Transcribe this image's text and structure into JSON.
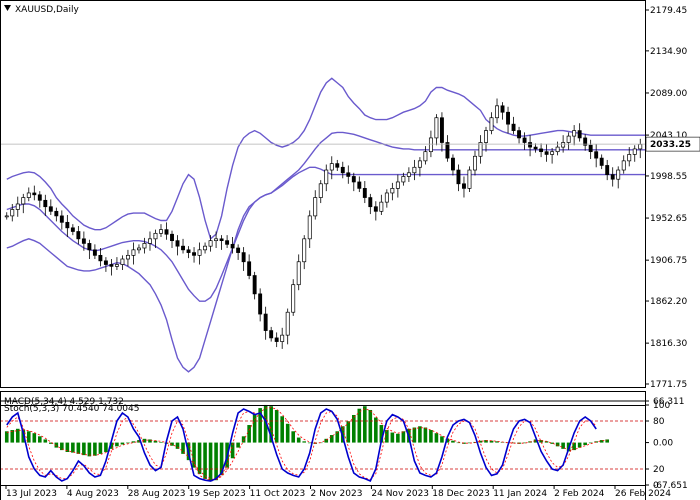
{
  "header": {
    "symbol_label": "XAUUSD,Daily",
    "symbol_icon": "triangle-down-icon"
  },
  "chart_data": [
    {
      "type": "candlestick",
      "symbol": "XAUUSD",
      "timeframe": "Daily",
      "current_price_label": "2033.25",
      "y_ticks": [
        "2179.45",
        "2134.90",
        "2089.00",
        "2043.10",
        "1998.55",
        "1952.65",
        "1906.75",
        "1862.20",
        "1816.30",
        "1771.75"
      ],
      "ylim": [
        1771.75,
        2179.45
      ],
      "x_ticks": [
        "13 Jul 2023",
        "4 Aug 2023",
        "28 Aug 2023",
        "19 Sep 2023",
        "11 Oct 2023",
        "2 Nov 2023",
        "24 Nov 2023",
        "18 Dec 2023",
        "11 Jan 2024",
        "2 Feb 2024",
        "26 Feb 2024"
      ],
      "close": [
        1955,
        1962,
        1968,
        1975,
        1980,
        1978,
        1972,
        1965,
        1960,
        1955,
        1948,
        1942,
        1938,
        1930,
        1925,
        1918,
        1912,
        1906,
        1902,
        1900,
        1902,
        1908,
        1912,
        1918,
        1920,
        1925,
        1930,
        1936,
        1940,
        1935,
        1928,
        1922,
        1918,
        1915,
        1912,
        1918,
        1922,
        1928,
        1930,
        1928,
        1924,
        1920,
        1915,
        1905,
        1890,
        1870,
        1848,
        1830,
        1822,
        1818,
        1825,
        1850,
        1880,
        1905,
        1930,
        1955,
        1975,
        1990,
        2005,
        2012,
        2008,
        2002,
        1998,
        1992,
        1985,
        1975,
        1965,
        1960,
        1970,
        1980,
        1985,
        1992,
        1998,
        2002,
        2008,
        2015,
        2025,
        2040,
        2062,
        2035,
        2018,
        2005,
        1990,
        1985,
        2005,
        2020,
        2035,
        2048,
        2062,
        2075,
        2068,
        2055,
        2048,
        2040,
        2035,
        2030,
        2028,
        2025,
        2022,
        2025,
        2030,
        2035,
        2042,
        2048,
        2040,
        2032,
        2025,
        2018,
        2010,
        2000,
        1995,
        2005,
        2015,
        2022,
        2028,
        2033
      ],
      "bollinger_upper": [
        1995,
        1998,
        2000,
        2002,
        2003,
        2002,
        1998,
        1992,
        1985,
        1975,
        1968,
        1962,
        1955,
        1950,
        1945,
        1942,
        1940,
        1940,
        1942,
        1946,
        1950,
        1954,
        1957,
        1958,
        1958,
        1958,
        1955,
        1952,
        1950,
        1950,
        1960,
        1975,
        1990,
        2000,
        1995,
        1975,
        1950,
        1930,
        1935,
        1955,
        1985,
        2010,
        2030,
        2040,
        2045,
        2048,
        2045,
        2040,
        2035,
        2032,
        2030,
        2032,
        2035,
        2040,
        2048,
        2060,
        2075,
        2090,
        2100,
        2105,
        2100,
        2095,
        2085,
        2078,
        2072,
        2065,
        2062,
        2060,
        2060,
        2060,
        2062,
        2065,
        2068,
        2070,
        2072,
        2075,
        2080,
        2090,
        2095,
        2095,
        2092,
        2090,
        2088,
        2085,
        2080,
        2075,
        2070,
        2060,
        2055,
        2050,
        2047,
        2045,
        2043,
        2042,
        2042,
        2043,
        2044,
        2045,
        2046,
        2047,
        2048,
        2048,
        2047,
        2046,
        2045,
        2044,
        2043,
        2043,
        2043,
        2043,
        2043,
        2043,
        2043,
        2043,
        2043,
        2043,
        2043
      ],
      "bollinger_middle": [
        1962,
        1964,
        1966,
        1968,
        1968,
        1966,
        1962,
        1956,
        1950,
        1944,
        1938,
        1933,
        1928,
        1924,
        1920,
        1918,
        1917,
        1918,
        1920,
        1922,
        1924,
        1926,
        1927,
        1928,
        1928,
        1927,
        1925,
        1922,
        1918,
        1912,
        1905,
        1895,
        1885,
        1875,
        1868,
        1862,
        1862,
        1866,
        1876,
        1890,
        1905,
        1920,
        1935,
        1950,
        1962,
        1970,
        1975,
        1978,
        1980,
        1985,
        1990,
        1995,
        2000,
        2005,
        2012,
        2020,
        2028,
        2035,
        2040,
        2045,
        2046,
        2046,
        2045,
        2044,
        2042,
        2040,
        2038,
        2036,
        2034,
        2032,
        2030,
        2029,
        2028,
        2028,
        2027,
        2027,
        2027,
        2027,
        2027,
        2027,
        2027,
        2027,
        2027,
        2027,
        2027,
        2027,
        2027,
        2027,
        2027,
        2027,
        2027,
        2027,
        2027,
        2027,
        2027,
        2027,
        2027,
        2027,
        2027,
        2027,
        2027,
        2027,
        2027,
        2027,
        2027,
        2027,
        2027,
        2027,
        2027,
        2027,
        2027,
        2027,
        2027,
        2027,
        2027,
        2027,
        2027
      ],
      "bollinger_lower": [
        1920,
        1922,
        1925,
        1928,
        1930,
        1928,
        1925,
        1920,
        1915,
        1910,
        1905,
        1900,
        1898,
        1896,
        1895,
        1895,
        1896,
        1898,
        1900,
        1902,
        1904,
        1903,
        1900,
        1896,
        1892,
        1886,
        1880,
        1870,
        1858,
        1842,
        1820,
        1800,
        1790,
        1785,
        1790,
        1800,
        1820,
        1840,
        1860,
        1880,
        1900,
        1920,
        1940,
        1955,
        1965,
        1970,
        1975,
        1978,
        1980,
        1984,
        1988,
        1993,
        1998,
        2002,
        2005,
        2008,
        2008,
        2006,
        2003,
        2000,
        2000,
        2000,
        2000,
        2000,
        2000,
        2000,
        2000,
        2000,
        2000,
        2000,
        2000,
        2000,
        2000,
        2000,
        2000,
        2000,
        2000,
        2000,
        2000,
        2000,
        2000,
        2000,
        2000,
        2000,
        2000,
        2000,
        2000,
        2000,
        2000,
        2000,
        2000,
        2000,
        2000,
        2000,
        2000,
        2000,
        2000,
        2000,
        2000,
        2000,
        2000,
        2000,
        2000,
        2000,
        2000,
        2000,
        2000,
        2000,
        2000,
        2000,
        2000,
        2000,
        2000,
        2000,
        2000,
        2000,
        2000
      ],
      "colors": {
        "bollinger": "#6a5acd",
        "candle_up": "#000000",
        "candle_down": "#000000"
      }
    },
    {
      "type": "bar",
      "label": "MACD(5,34,4) 4.529 1.732",
      "y_ticks": [
        "66.311",
        "0.00",
        "-67.651"
      ],
      "ylim": [
        -67.651,
        66.311
      ],
      "histogram": [
        18,
        20,
        22,
        21,
        18,
        15,
        10,
        5,
        -2,
        -8,
        -12,
        -15,
        -16,
        -18,
        -20,
        -22,
        -21,
        -18,
        -15,
        -10,
        -6,
        -3,
        -1,
        2,
        4,
        6,
        5,
        3,
        1,
        -2,
        -5,
        -10,
        -18,
        -28,
        -40,
        -50,
        -58,
        -62,
        -60,
        -52,
        -40,
        -25,
        -8,
        10,
        28,
        45,
        55,
        60,
        58,
        52,
        42,
        30,
        18,
        8,
        2,
        -1,
        -2,
        0,
        6,
        12,
        18,
        26,
        34,
        44,
        54,
        58,
        52,
        40,
        28,
        20,
        16,
        14,
        18,
        22,
        24,
        26,
        24,
        20,
        15,
        10,
        6,
        3,
        0,
        -2,
        -1,
        1,
        3,
        4,
        3,
        2,
        1,
        0,
        -1,
        -2,
        -1,
        2,
        5,
        4,
        2,
        -2,
        -6,
        -10,
        -14,
        -12,
        -8,
        -4,
        -1,
        2,
        4,
        5
      ],
      "signal": [
        16,
        18,
        19,
        20,
        19,
        16,
        12,
        7,
        1,
        -5,
        -10,
        -13,
        -15,
        -17,
        -19,
        -20,
        -20,
        -19,
        -16,
        -12,
        -8,
        -4,
        -2,
        0,
        2,
        4,
        4,
        3,
        2,
        0,
        -3,
        -7,
        -14,
        -23,
        -34,
        -45,
        -53,
        -58,
        -59,
        -54,
        -44,
        -30,
        -14,
        3,
        20,
        36,
        48,
        55,
        56,
        53,
        45,
        34,
        22,
        12,
        5,
        1,
        -1,
        0,
        4,
        10,
        16,
        23,
        31,
        40,
        49,
        54,
        51,
        42,
        31,
        23,
        18,
        15,
        17,
        20,
        22,
        24,
        23,
        20,
        16,
        11,
        7,
        4,
        1,
        -1,
        -1,
        0,
        2,
        3,
        3,
        2,
        1,
        0,
        -1,
        -1,
        -1,
        1,
        3,
        3,
        2,
        -1,
        -4,
        -8,
        -11,
        -11,
        -8,
        -5,
        -2,
        1,
        3,
        4
      ],
      "colors": {
        "histogram": "#008000",
        "signal": "#ff0000"
      }
    },
    {
      "type": "line",
      "label": "Stoch(5,3,3) 70.4540 74.0045",
      "y_ticks": [
        "100",
        "80",
        "20",
        "0"
      ],
      "ylim": [
        0,
        100
      ],
      "levels": [
        80,
        20
      ],
      "main": [
        75,
        85,
        90,
        65,
        35,
        20,
        12,
        10,
        18,
        10,
        5,
        8,
        18,
        30,
        24,
        15,
        10,
        12,
        30,
        55,
        80,
        90,
        85,
        70,
        60,
        40,
        25,
        18,
        22,
        55,
        80,
        85,
        70,
        40,
        12,
        8,
        6,
        5,
        8,
        15,
        35,
        65,
        90,
        95,
        92,
        88,
        90,
        80,
        60,
        38,
        20,
        15,
        12,
        10,
        20,
        40,
        70,
        90,
        95,
        92,
        82,
        60,
        35,
        15,
        10,
        8,
        5,
        20,
        55,
        80,
        88,
        85,
        80,
        60,
        30,
        15,
        12,
        10,
        15,
        35,
        60,
        75,
        80,
        82,
        78,
        62,
        40,
        22,
        12,
        14,
        25,
        50,
        70,
        80,
        82,
        78,
        60,
        42,
        30,
        20,
        18,
        25,
        45,
        65,
        80,
        85,
        80,
        70
      ],
      "signal": [
        72,
        80,
        85,
        72,
        48,
        30,
        18,
        12,
        14,
        12,
        8,
        8,
        14,
        24,
        26,
        20,
        14,
        13,
        22,
        42,
        65,
        80,
        85,
        76,
        65,
        50,
        36,
        25,
        22,
        40,
        65,
        80,
        75,
        55,
        28,
        12,
        8,
        6,
        7,
        12,
        25,
        50,
        78,
        90,
        92,
        90,
        89,
        84,
        70,
        50,
        30,
        19,
        14,
        12,
        16,
        30,
        55,
        78,
        90,
        92,
        86,
        70,
        48,
        26,
        14,
        9,
        7,
        14,
        40,
        68,
        82,
        85,
        82,
        70,
        45,
        24,
        15,
        12,
        13,
        25,
        48,
        66,
        76,
        80,
        79,
        70,
        52,
        33,
        20,
        15,
        20,
        38,
        58,
        73,
        80,
        80,
        70,
        54,
        40,
        28,
        22,
        24,
        36,
        54,
        72,
        80,
        80,
        74
      ],
      "colors": {
        "main": "#0000cd",
        "signal": "#ff0000",
        "levels": "#cc0000"
      }
    }
  ]
}
